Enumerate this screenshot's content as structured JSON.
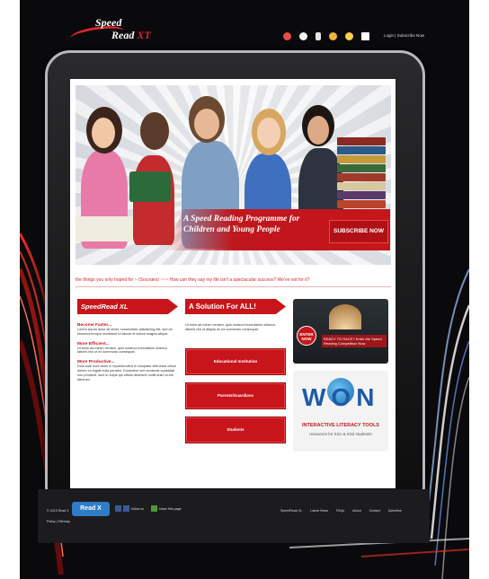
{
  "header": {
    "logo_line1": "Speed",
    "logo_line2": "Read",
    "logo_suffix": "XT",
    "login_text": "Login | Subscribe Now",
    "icon_colors": [
      "#e94b4b",
      "#f2f2f2",
      "#e5e5e5",
      "#f0b63a",
      "#f5d04a",
      "#ffffff"
    ]
  },
  "hero": {
    "banner_text": "A Speed Reading Programme for Children and Young People",
    "subscribe_label": "SUBSCRIBE NOW"
  },
  "ticker": "the things you only hoped for ~ (Socrates) ~~~ How can they say my life isn't a spectacular success? We've not for it?",
  "col1": {
    "title": "SpeedRead XL",
    "sections": [
      {
        "heading": "Become Faster...",
        "text": "Lorem ipsum dolor sit amet, consectetur adipisicing elit, sed do eiusmod tempor incididunt ut labore et dolore magna aliqua."
      },
      {
        "heading": "More Efficient...",
        "text": "Ut enim ad minim veniam, quis nostrud exercitation ullamco laboris nisi ut ex commodo consequat."
      },
      {
        "heading": "More Productive...",
        "text": "Duis aute irure dolor in reprehenderit in voluptate velit esse cillum dolore eu fugiat nulla pariatur. Excepteur sint occaecat cupidatat non proident, sunt in culpa qui officia deserunt mollit anim id est laborum."
      }
    ]
  },
  "col2": {
    "title": "A Solution For ALL!",
    "intro": "Ut enim ad minim veniam, quis nostrud exercitation ullamco laboris nisi ut aliquip ex ea commodo consequat.",
    "buttons": [
      "Educational Institution",
      "Parents/Guardians",
      "Students"
    ]
  },
  "col3": {
    "enter_label": "ENTER NOW",
    "ready_text": "READY TO RACE? Enter the Speed Reading Competition Now",
    "won_text": "WON",
    "literacy_label": "INTERACTIVE LITERACY TOOLS",
    "resources_label": "resources for KS1 & KS2 students!"
  },
  "footer": {
    "copyright": "© 2013 Read X",
    "badge": "Read X",
    "social1": "follow us",
    "social2": "share this page",
    "policy": "Policy | Sitemap",
    "links": [
      "SpeedRead XL",
      "Latest News",
      "FAQs",
      "About",
      "Contact",
      "Advertise"
    ]
  }
}
